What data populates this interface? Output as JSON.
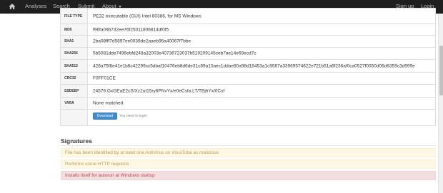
{
  "navbar": {
    "home_icon": "home-icon",
    "analyses": "Analyses",
    "search": "Search",
    "submit": "Submit",
    "about": "About",
    "signup": "Sign up",
    "login": "Login"
  },
  "file_info": {
    "rows": [
      {
        "key": "FILE TYPE",
        "value": "PE32 executable (GUI) Intel 80386, for MS Windows"
      },
      {
        "key": "MD5",
        "value": "f96fa09b732ee76f25011806814df0f5"
      },
      {
        "key": "SHA1",
        "value": "2ba08fff7d5897ee0039de2aaeb96a40067f7bbe"
      },
      {
        "key": "SHA256",
        "value": "5b5081dde7496ebfd248a32003e40736723037b519209145ceb7ae14e69ecd7c"
      },
      {
        "key": "SHA512",
        "value": "428a75f8e41e1b6c42299cc5dbaf10476eb8d6de31c89a10aec1ddae80a98d18453a1c9567a33969574622e721b51a6f236af0ca0527f0050d06d6359c3d999e"
      },
      {
        "key": "CRC32",
        "value": "F0FF01CE"
      },
      {
        "key": "SSDEEP",
        "value": "24576:GxGEaE2cS/Xz2ut15ry6PNvYx/e0eCsfa:LT/TBjhYx/0Csf"
      },
      {
        "key": "YARA",
        "value": "None matched"
      }
    ],
    "download_label": "Download",
    "login_note": "You need to login"
  },
  "signatures": {
    "title": "Signatures",
    "items": [
      {
        "text": "File has been identified by at least one AntiVirus on VirusTotal as malicious",
        "severity": "warning"
      },
      {
        "text": "Performs some HTTP requests",
        "severity": "warning"
      },
      {
        "text": "Installs itself for autorun at Windows startup",
        "severity": "danger"
      }
    ]
  },
  "colors": {
    "navbar_bg": "#1f1f1f",
    "primary": "#428bca",
    "warning_bg": "#fcf8e3",
    "warning_text": "#c09853",
    "danger_bg": "#f2dede",
    "danger_text": "#b94a48"
  }
}
